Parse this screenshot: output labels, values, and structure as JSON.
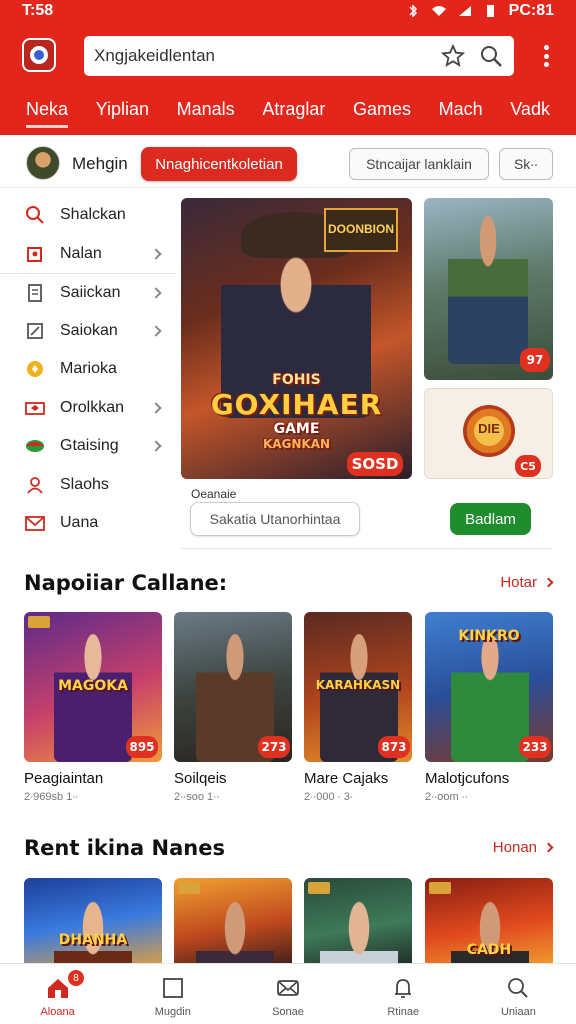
{
  "status": {
    "time": "T:58",
    "clock": "PC:81"
  },
  "search": {
    "value": "Xngjakeidlentan"
  },
  "tabs": [
    "Neka",
    "Yiplian",
    "Manals",
    "Atraglar",
    "Games",
    "Mach",
    "Vadk"
  ],
  "filter": {
    "username": "Mehgin",
    "primary_pill": "Nnaghicentkoletian",
    "secondary_btn": "Stncaijar lanklain",
    "dropdown": "Sk∙∙"
  },
  "sidebar": {
    "items": [
      {
        "label": "Shalckan",
        "icon": "search-icon",
        "chevron": false
      },
      {
        "label": "Nalan",
        "icon": "puzzle-icon",
        "chevron": true
      },
      {
        "label": "Saiickan",
        "icon": "document-icon",
        "chevron": true
      },
      {
        "label": "Saiokan",
        "icon": "edit-icon",
        "chevron": true
      },
      {
        "label": "Marioka",
        "icon": "coin-icon",
        "chevron": false
      },
      {
        "label": "Orolkkan",
        "icon": "ticket-icon",
        "chevron": true
      },
      {
        "label": "Gtaising",
        "icon": "flag-icon",
        "chevron": true
      },
      {
        "label": "Slaohs",
        "icon": "user-icon",
        "chevron": false
      },
      {
        "label": "Uana",
        "icon": "mail-icon",
        "chevron": false
      }
    ]
  },
  "featured": {
    "banner_sign": "DOONBION",
    "banner_lines": [
      "FOHIS",
      "GOXIHAER",
      "GAME",
      "KAGNKAN"
    ],
    "banner_badge": "SOSD",
    "card1_badge": "97",
    "card2_badge": "C5",
    "card2_emblem": "DIE",
    "label": "Oeanaie",
    "input_value": "Sakatia Utanorhintaa",
    "action_btn": "Badlam"
  },
  "popular": {
    "title": "Napoiiar Callane:",
    "more": "Hotar",
    "games": [
      {
        "title": "Peagiaintan",
        "meta": "2∙969sb 1∙∙",
        "badge": "895",
        "art": "MAGOKA"
      },
      {
        "title": "Soilqeis",
        "meta": "2∙∙soo 1∙∙",
        "badge": "273",
        "art": ""
      },
      {
        "title": "Mare Cajaks",
        "meta": "2∙∙000 ∙ 3∙",
        "badge": "873",
        "art": "KARAHKASN"
      },
      {
        "title": "Malotjcufons",
        "meta": "2∙∙oom ∙∙",
        "badge": "233",
        "art": "KINKRO"
      }
    ]
  },
  "recent": {
    "title": "Rent ikina Nanes",
    "more": "Honan",
    "games": [
      {
        "art": "DHANHA"
      },
      {
        "art": ""
      },
      {
        "art": ""
      },
      {
        "art": "CADH"
      }
    ]
  },
  "nav": {
    "items": [
      {
        "label": "Aloana",
        "icon": "home-icon"
      },
      {
        "label": "Mugdin",
        "icon": "square-icon"
      },
      {
        "label": "Sonae",
        "icon": "envelope-icon"
      },
      {
        "label": "Rtinae",
        "icon": "bell-icon"
      },
      {
        "label": "Uniaan",
        "icon": "search-icon"
      }
    ],
    "badge": "8"
  },
  "colors": {
    "brand_red": "#e2261c",
    "action_green": "#1f8c2e",
    "accent_red_text": "#c5291f"
  }
}
